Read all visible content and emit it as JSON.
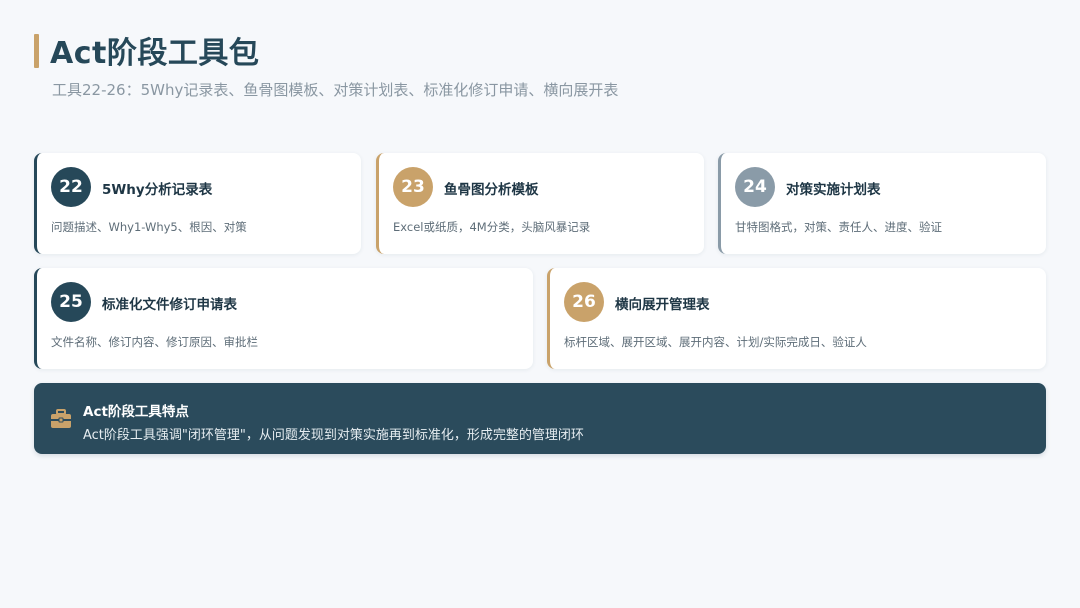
{
  "page": {
    "title": "Act阶段工具包",
    "subtitle": "工具22-26：5Why记录表、鱼骨图模板、对策计划表、标准化修订申请、横向展开表"
  },
  "colors": {
    "accent_gold": "#c9a26a",
    "navy": "#264859",
    "slate": "#8a9ba8"
  },
  "tools": [
    {
      "number": "22",
      "title": "5Why分析记录表",
      "description": "问题描述、Why1-Why5、根因、对策",
      "color": "#264859"
    },
    {
      "number": "23",
      "title": "鱼骨图分析模板",
      "description": "Excel或纸质，4M分类，头脑风暴记录",
      "color": "#c9a26a"
    },
    {
      "number": "24",
      "title": "对策实施计划表",
      "description": "甘特图格式，对策、责任人、进度、验证",
      "color": "#8a9ba8"
    },
    {
      "number": "25",
      "title": "标准化文件修订申请表",
      "description": "文件名称、修订内容、修订原因、审批栏",
      "color": "#264859"
    },
    {
      "number": "26",
      "title": "横向展开管理表",
      "description": "标杆区域、展开区域、展开内容、计划/实际完成日、验证人",
      "color": "#c9a26a"
    }
  ],
  "summary": {
    "icon": "toolbox-icon",
    "title": "Act阶段工具特点",
    "description": "Act阶段工具强调\"闭环管理\"，从问题发现到对策实施再到标准化，形成完整的管理闭环"
  }
}
